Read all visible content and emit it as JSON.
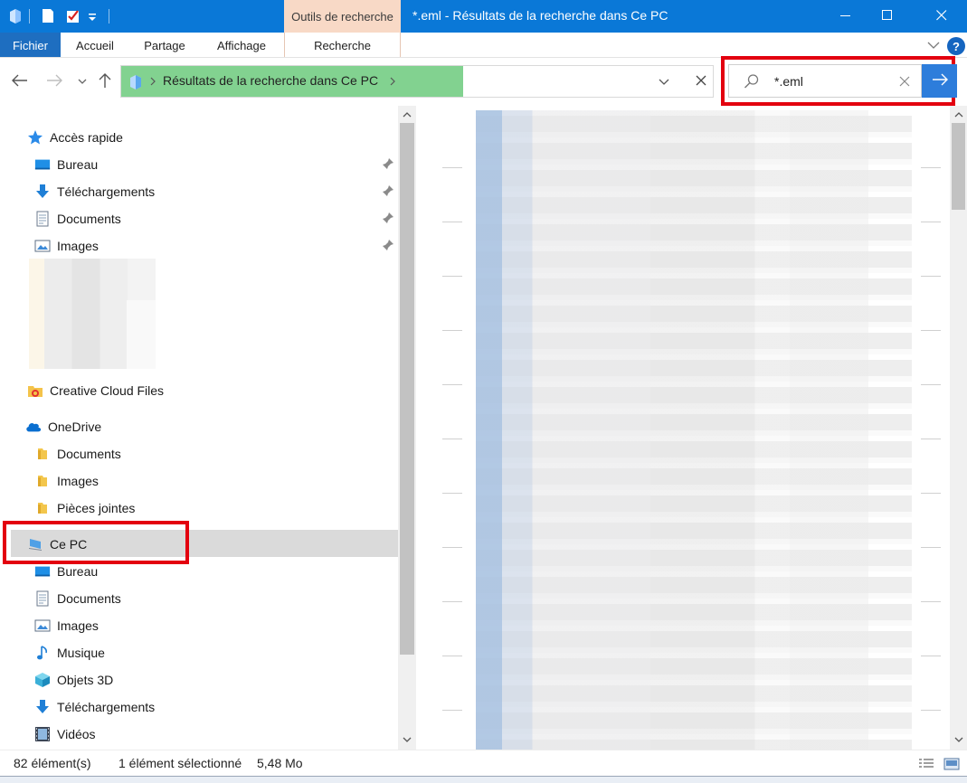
{
  "window": {
    "title": "*.eml - Résultats de la recherche dans Ce PC",
    "context_tab": "Outils de recherche",
    "minimize_icon": "minimize-icon",
    "maximize_icon": "maximize-icon",
    "close_icon": "close-icon",
    "accent": "#0a78d7"
  },
  "ribbon": {
    "tabs": [
      {
        "label": "Fichier"
      },
      {
        "label": "Accueil"
      },
      {
        "label": "Partage"
      },
      {
        "label": "Affichage"
      },
      {
        "label": "Recherche"
      }
    ],
    "help_label": "?"
  },
  "address": {
    "path": "Résultats de la recherche dans Ce PC"
  },
  "search": {
    "value": "*.eml",
    "highlight_color": "#e3000f"
  },
  "nav": {
    "quick_access": "Accès rapide",
    "quick_items": [
      {
        "label": "Bureau",
        "icon": "desktop-icon"
      },
      {
        "label": "Téléchargements",
        "icon": "download-icon"
      },
      {
        "label": "Documents",
        "icon": "documents-icon"
      },
      {
        "label": "Images",
        "icon": "images-icon"
      }
    ],
    "creative_cloud": "Creative Cloud Files",
    "onedrive": "OneDrive",
    "onedrive_items": [
      {
        "label": "Documents",
        "icon": "folder-icon"
      },
      {
        "label": "Images",
        "icon": "folder-icon"
      },
      {
        "label": "Pièces jointes",
        "icon": "folder-icon"
      }
    ],
    "this_pc": "Ce PC",
    "pc_items": [
      {
        "label": "Bureau",
        "icon": "desktop-icon"
      },
      {
        "label": "Documents",
        "icon": "documents-icon"
      },
      {
        "label": "Images",
        "icon": "images-icon"
      },
      {
        "label": "Musique",
        "icon": "music-icon"
      },
      {
        "label": "Objets 3D",
        "icon": "objects-3d-icon"
      },
      {
        "label": "Téléchargements",
        "icon": "download-icon"
      },
      {
        "label": "Vidéos",
        "icon": "videos-icon"
      }
    ]
  },
  "status": {
    "count": "82 élément(s)",
    "selection": "1 élément sélectionné",
    "size": "5,48 Mo"
  }
}
